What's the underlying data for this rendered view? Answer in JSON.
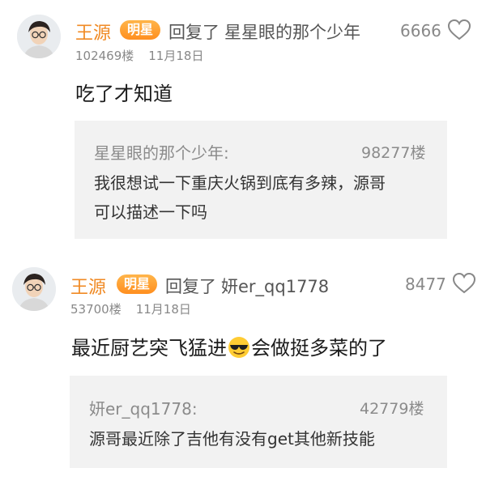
{
  "comments": [
    {
      "user": "王源",
      "badge": "明星",
      "reply_label": "回复了",
      "reply_to": "星星眼的那个少年",
      "likes": "6666",
      "floor": "102469楼",
      "date": "11月18日",
      "content": "吃了才知道",
      "quote": {
        "author": "星星眼的那个少年:",
        "floor": "98277楼",
        "lines": [
          "我很想试一下重庆火锅到底有多辣，源哥",
          "可以描述一下吗"
        ]
      }
    },
    {
      "user": "王源",
      "badge": "明星",
      "reply_label": "回复了",
      "reply_to": "妍er_qq1778",
      "likes": "8477",
      "floor": "53700楼",
      "date": "11月18日",
      "content_before": "最近厨艺突飞猛进",
      "content_after": "会做挺多菜的了",
      "emoji": "sunglasses-emoji",
      "quote": {
        "author": "妍er_qq1778:",
        "floor": "42779楼",
        "lines": [
          "源哥最近除了吉他有没有get其他新技能"
        ]
      }
    }
  ],
  "colors": {
    "accent": "#f08a24",
    "quote_bg": "#f2f2f2"
  }
}
